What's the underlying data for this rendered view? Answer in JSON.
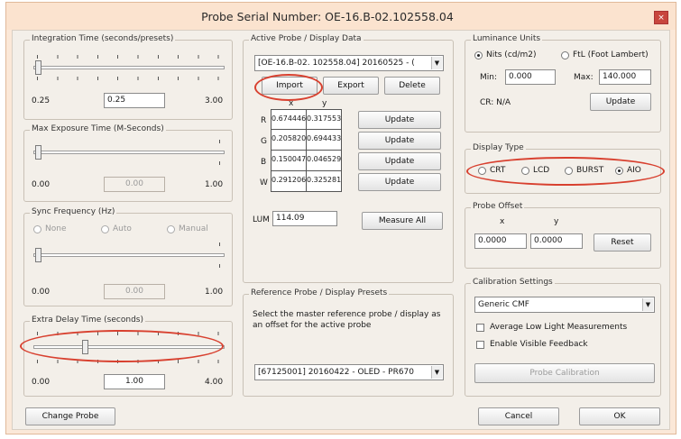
{
  "window": {
    "title": "Probe Serial Number: OE-16.B-02.102558.04",
    "close_glyph": "×"
  },
  "integration": {
    "legend": "Integration Time (seconds/presets)",
    "min": "0.25",
    "value": "0.25",
    "max": "3.00"
  },
  "exposure": {
    "legend": "Max Exposure Time (M-Seconds)",
    "min": "0.00",
    "value": "0.00",
    "max": "1.00"
  },
  "sync": {
    "legend": "Sync Frequency (Hz)",
    "options": [
      "None",
      "Auto",
      "Manual"
    ],
    "min": "0.00",
    "value": "0.00",
    "max": "1.00"
  },
  "delay": {
    "legend": "Extra Delay Time (seconds)",
    "min": "0.00",
    "value": "1.00",
    "max": "4.00"
  },
  "change_probe": "Change Probe",
  "active": {
    "legend": "Active Probe / Display Data",
    "selected": "[OE-16.B-02. 102558.04] 20160525 - (",
    "import": "Import",
    "export": "Export",
    "delete": "Delete",
    "x_header": "x",
    "y_header": "y",
    "rows": [
      {
        "label": "R",
        "x": "0.674446",
        "y": "0.317553",
        "button": "Update"
      },
      {
        "label": "G",
        "x": "0.205820",
        "y": "0.694433",
        "button": "Update"
      },
      {
        "label": "B",
        "x": "0.150047",
        "y": "0.046529",
        "button": "Update"
      },
      {
        "label": "W",
        "x": "0.291206",
        "y": "0.325281",
        "button": "Update"
      }
    ],
    "lum_label": "LUM",
    "lum_value": "114.09",
    "measure_all": "Measure All"
  },
  "reference": {
    "legend": "Reference Probe / Display Presets",
    "description": "Select the master reference probe / display as an offset for the active probe",
    "selected": "[67125001] 20160422 - OLED - PR670"
  },
  "luminance": {
    "legend": "Luminance Units",
    "opt_nits": "Nits (cd/m2)",
    "opt_ftl": "FtL (Foot Lambert)",
    "min_label": "Min:",
    "min_value": "0.000",
    "max_label": "Max:",
    "max_value": "140.000",
    "cr": "CR: N/A",
    "update": "Update"
  },
  "display_type": {
    "legend": "Display Type",
    "options": [
      "CRT",
      "LCD",
      "BURST",
      "AIO"
    ],
    "selected": "AIO"
  },
  "offset": {
    "legend": "Probe Offset",
    "x_label": "x",
    "y_label": "y",
    "x_value": "0.0000",
    "y_value": "0.0000",
    "reset": "Reset"
  },
  "calibration": {
    "legend": "Calibration Settings",
    "selected": "Generic CMF",
    "avg_low_light": "Average Low Light Measurements",
    "visible_feedback": "Enable Visible Feedback",
    "probe_calibration": "Probe Calibration"
  },
  "footer": {
    "cancel": "Cancel",
    "ok": "OK"
  },
  "colors": {
    "accent_highlight": "#d8402f",
    "titlebar": "#fbe3cf",
    "close": "#c8463d"
  }
}
